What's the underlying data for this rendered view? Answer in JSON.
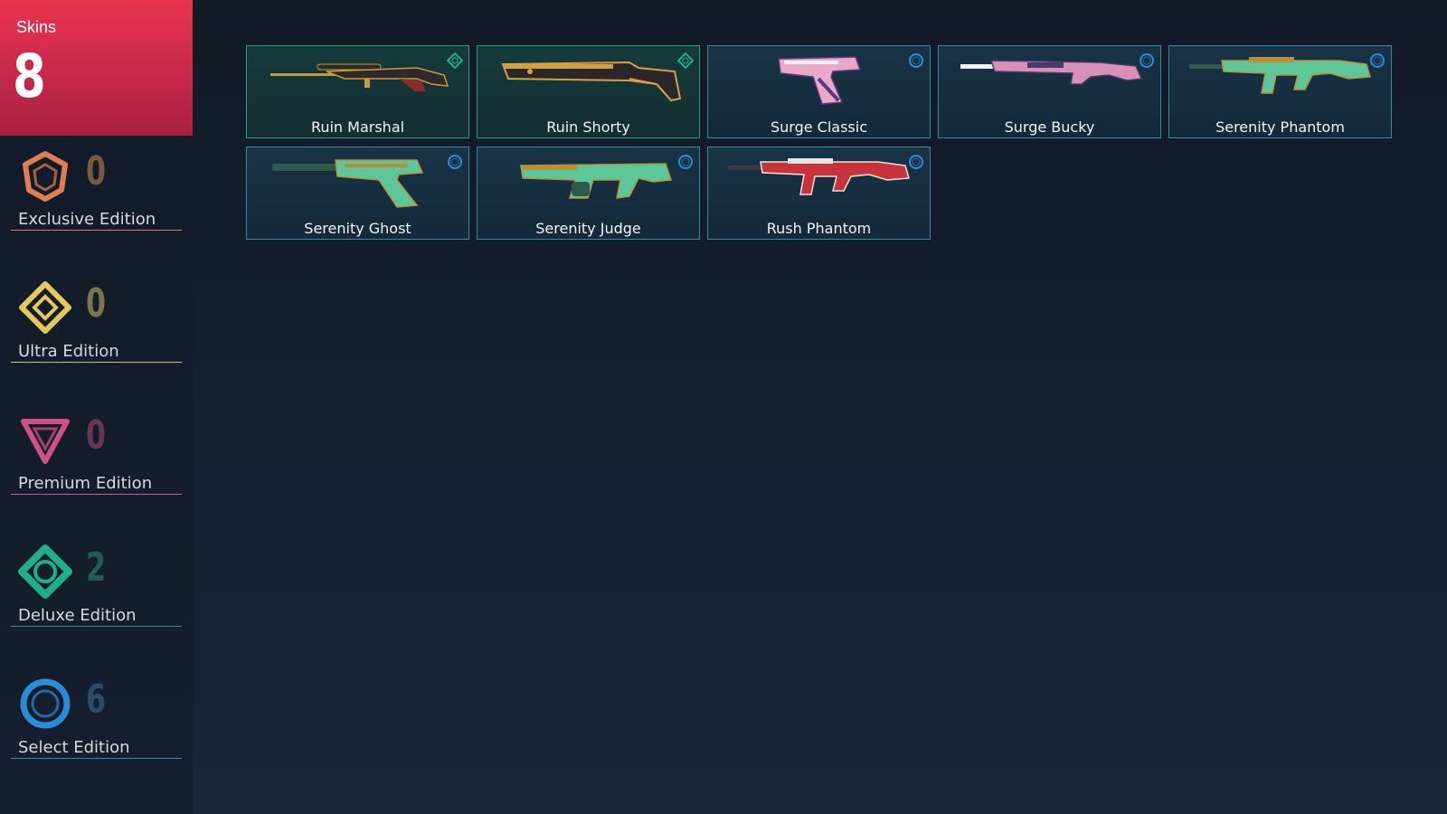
{
  "summary": {
    "label": "Skins",
    "count": "8"
  },
  "editions": [
    {
      "id": "exclusive",
      "label": "Exclusive Edition",
      "count": "0",
      "color": "#e07d52",
      "count_color": "#7a5a3c",
      "line_color": "#c0866a"
    },
    {
      "id": "ultra",
      "label": "Ultra Edition",
      "count": "0",
      "color": "#e5c95a",
      "count_color": "#7c7646",
      "line_color": "#c9c08a"
    },
    {
      "id": "premium",
      "label": "Premium Edition",
      "count": "0",
      "color": "#d04f86",
      "count_color": "#6c3450",
      "line_color": "#b36a8a"
    },
    {
      "id": "deluxe",
      "label": "Deluxe Edition",
      "count": "2",
      "color": "#1fae8e",
      "count_color": "#1d5d55",
      "line_color": "#2f8f7c"
    },
    {
      "id": "select",
      "label": "Select Edition",
      "count": "6",
      "color": "#2b8bd6",
      "count_color": "#2a4b6a",
      "line_color": "#4a7fa8"
    }
  ],
  "skins": [
    {
      "name": "Ruin Marshal",
      "tier": "deluxe",
      "tier_icon": "deluxe-tier-icon",
      "palette": [
        "#2c2a2a",
        "#c89a3c",
        "#8f2a2a"
      ],
      "shape": "sniper"
    },
    {
      "name": "Ruin Shorty",
      "tier": "deluxe",
      "tier_icon": "deluxe-tier-icon",
      "palette": [
        "#2a2728",
        "#d4a040",
        "#6e2a24"
      ],
      "shape": "shotgun"
    },
    {
      "name": "Surge Classic",
      "tier": "select",
      "tier_icon": "select-tier-icon",
      "palette": [
        "#e8a8c8",
        "#5a3a7a",
        "#ffffff"
      ],
      "shape": "pistol"
    },
    {
      "name": "Surge Bucky",
      "tier": "select",
      "tier_icon": "select-tier-icon",
      "palette": [
        "#d890b8",
        "#4a3a6a",
        "#f0f0f0"
      ],
      "shape": "long"
    },
    {
      "name": "Serenity Phantom",
      "tier": "select",
      "tier_icon": "select-tier-icon",
      "palette": [
        "#5ec79a",
        "#b8903a",
        "#2f5a48"
      ],
      "shape": "rifle"
    },
    {
      "name": "Serenity Ghost",
      "tier": "select",
      "tier_icon": "select-tier-icon",
      "palette": [
        "#5ec79a",
        "#b8903a",
        "#2f5a48"
      ],
      "shape": "ghost"
    },
    {
      "name": "Serenity Judge",
      "tier": "select",
      "tier_icon": "select-tier-icon",
      "palette": [
        "#5ec79a",
        "#b8903a",
        "#2f5a48"
      ],
      "shape": "judge"
    },
    {
      "name": "Rush Phantom",
      "tier": "select",
      "tier_icon": "select-tier-icon",
      "palette": [
        "#c8323a",
        "#e6e6e6",
        "#3a3a42"
      ],
      "shape": "rifle"
    }
  ]
}
